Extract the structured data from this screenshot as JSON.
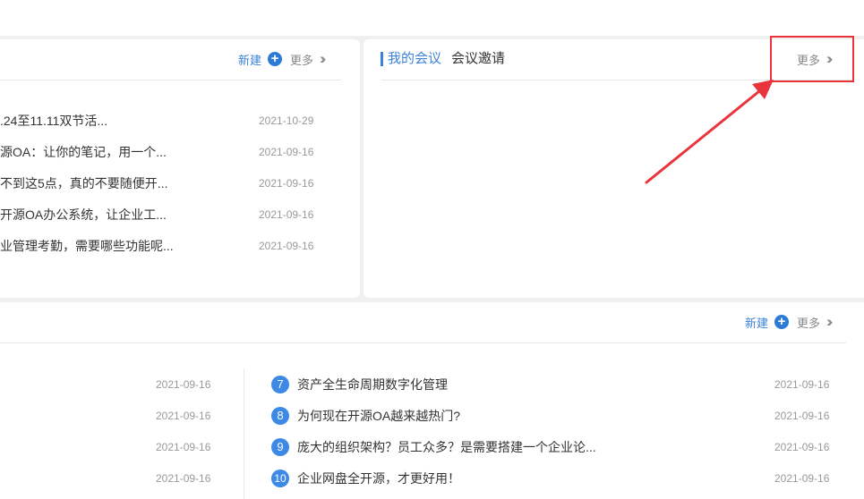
{
  "panel_left": {
    "new_label": "新建",
    "more_label": "更多",
    "items": [
      {
        "title": ".24至11.11双节活...",
        "date": "2021-10-29"
      },
      {
        "title": "源OA：让你的笔记，用一个...",
        "date": "2021-09-16"
      },
      {
        "title": "不到这5点，真的不要随便开...",
        "date": "2021-09-16"
      },
      {
        "title": "开源OA办公系统，让企业工...",
        "date": "2021-09-16"
      },
      {
        "title": "业管理考勤，需要哪些功能呢...",
        "date": "2021-09-16"
      }
    ]
  },
  "meeting": {
    "tab_active": "我的会议",
    "tab_inactive": "会议邀请",
    "more_label": "更多"
  },
  "bottom": {
    "new_label": "新建",
    "more_label": "更多",
    "left_dates": [
      "2021-09-16",
      "2021-09-16",
      "2021-09-16",
      "2021-09-16"
    ],
    "right_items": [
      {
        "num": "7",
        "title": "资产全生命周期数字化管理",
        "date": "2021-09-16"
      },
      {
        "num": "8",
        "title": "为何现在开源OA越来越热门?",
        "date": "2021-09-16"
      },
      {
        "num": "9",
        "title": "庞大的组织架构？员工众多？是需要搭建一个企业论...",
        "date": "2021-09-16"
      },
      {
        "num": "10",
        "title": "企业网盘全开源，才更好用！",
        "date": "2021-09-16"
      }
    ]
  },
  "icons": {
    "plus": "plus-circle-icon",
    "more": "double-chevron-right-icon"
  },
  "colors": {
    "accent": "#3c82d8",
    "badge": "#3d8ae6",
    "annotation": "#e8343a"
  }
}
